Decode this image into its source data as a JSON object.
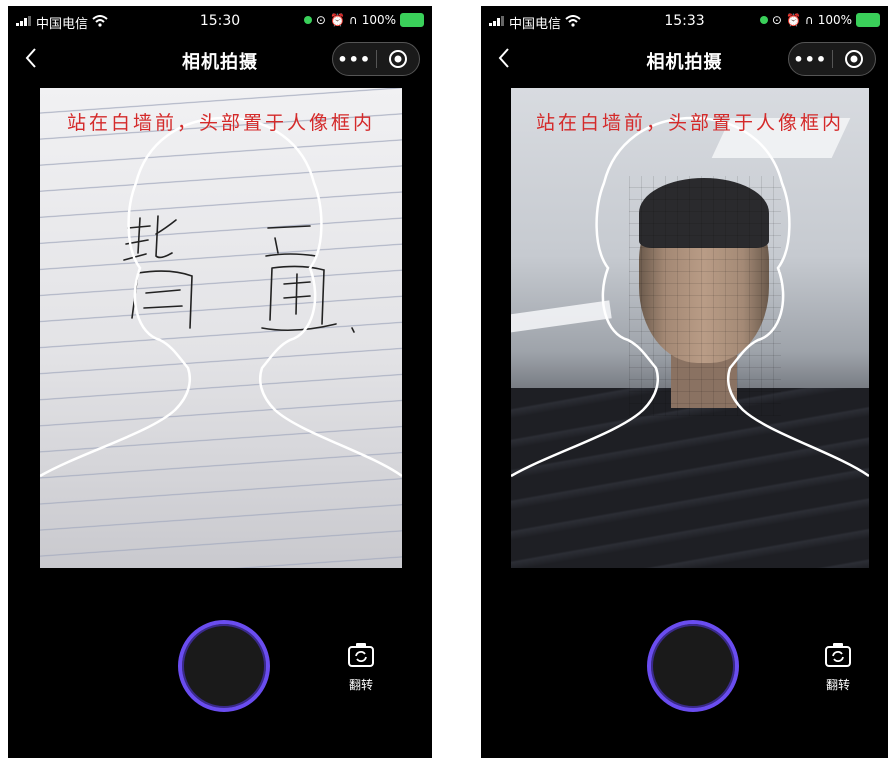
{
  "left_screen": {
    "status": {
      "carrier": "中国电信",
      "time": "15:30",
      "battery": "100%"
    },
    "nav": {
      "title": "相机拍摄",
      "more": "•••"
    },
    "prompt": "站在白墙前，头部置于人像框内",
    "flip_label": "翻转"
  },
  "right_screen": {
    "status": {
      "carrier": "中国电信",
      "time": "15:33",
      "battery": "100%"
    },
    "nav": {
      "title": "相机拍摄",
      "more": "•••"
    },
    "prompt": "站在白墙前，头部置于人像框内",
    "flip_label": "翻转"
  },
  "colors": {
    "prompt_text": "#d42a2a",
    "shutter_ring": "#6a4df0",
    "status_green": "#3ad05a"
  }
}
